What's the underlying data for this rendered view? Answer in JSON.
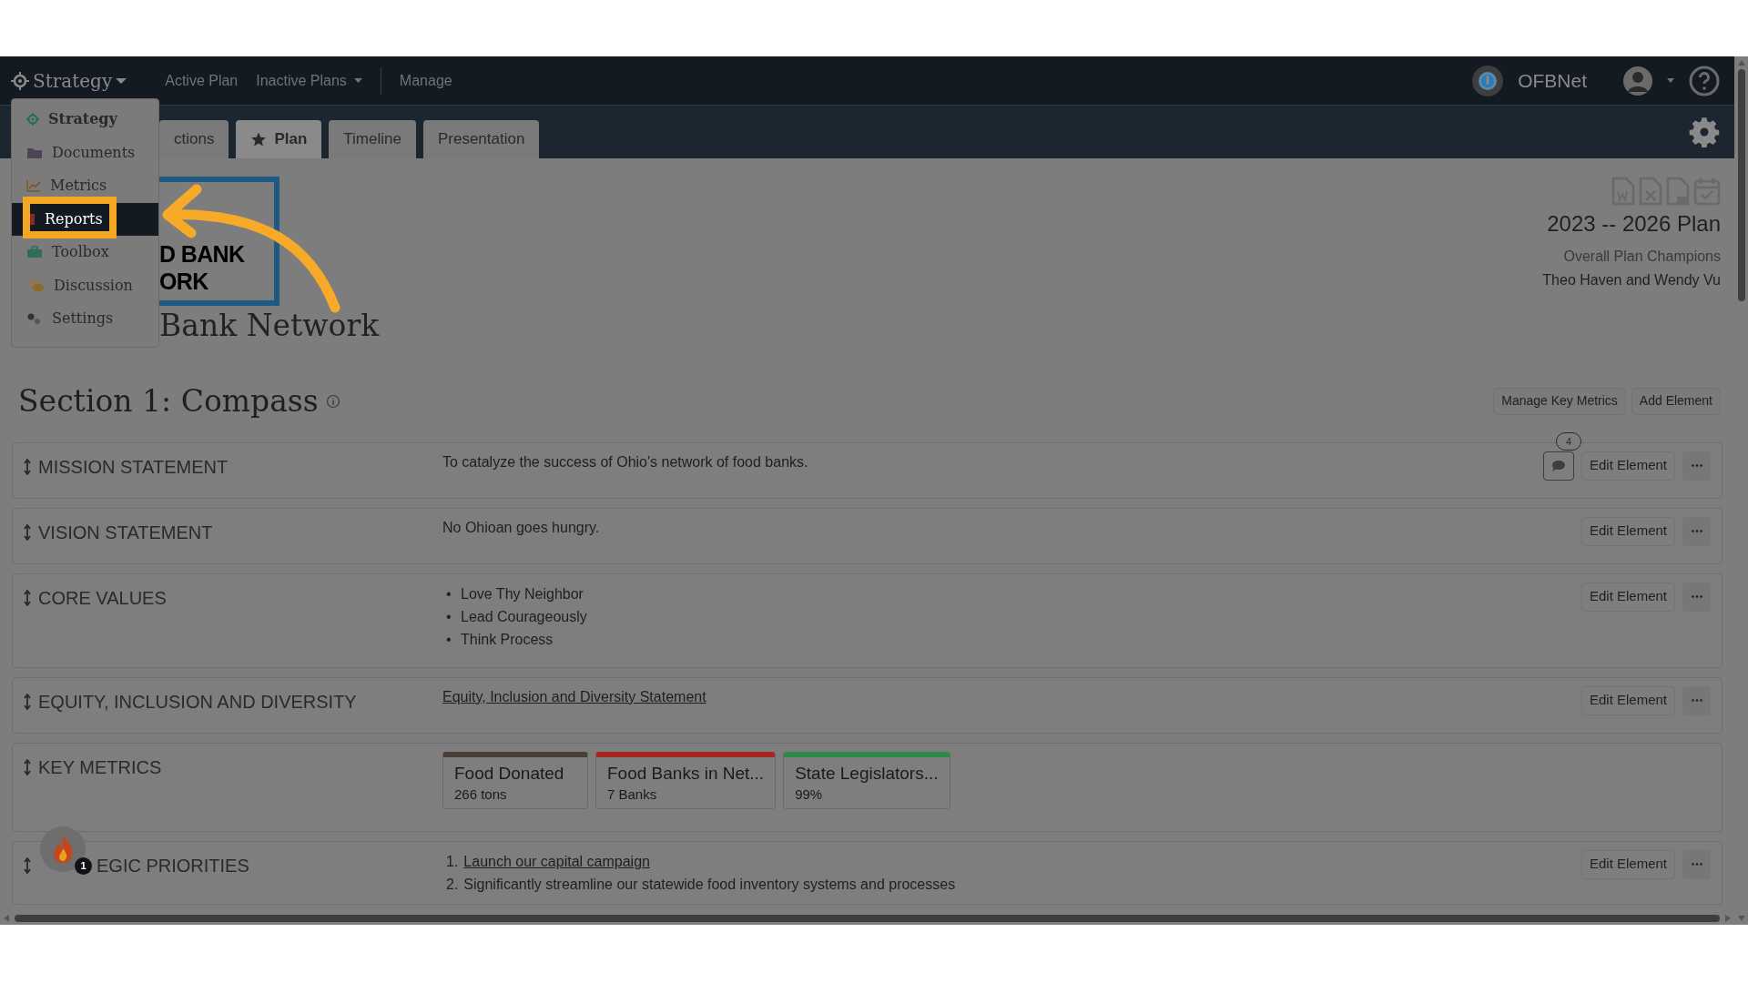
{
  "navbar": {
    "brand": "Strategy",
    "links": [
      {
        "label": "Active Plan",
        "dropdown": false
      },
      {
        "label": "Inactive Plans",
        "dropdown": true
      },
      {
        "label": "Manage",
        "dropdown": false
      }
    ],
    "org": "OFBNet"
  },
  "app_menu": [
    {
      "label": "Strategy",
      "kind": "strategy",
      "current": true,
      "selected": false
    },
    {
      "label": "Documents",
      "kind": "documents",
      "current": false,
      "selected": false
    },
    {
      "label": "Metrics",
      "kind": "metrics",
      "current": false,
      "selected": false
    },
    {
      "label": "Reports",
      "kind": "reports",
      "current": false,
      "selected": true
    },
    {
      "label": "Toolbox",
      "kind": "toolbox",
      "current": false,
      "selected": false
    },
    {
      "label": "Discussion",
      "kind": "discussion",
      "current": false,
      "selected": false
    },
    {
      "label": "Settings",
      "kind": "settings",
      "current": false,
      "selected": false
    }
  ],
  "tabs": [
    {
      "label": "ctions",
      "selected": false,
      "star": false
    },
    {
      "label": "Plan",
      "selected": true,
      "star": true
    },
    {
      "label": "Timeline",
      "selected": false,
      "star": false
    },
    {
      "label": "Presentation",
      "selected": false,
      "star": false
    }
  ],
  "logo": {
    "lines": [
      "D BANK",
      "ORK"
    ],
    "caption": "Bank Network"
  },
  "plan": {
    "title": "2023 -- 2026 Plan",
    "champions_label": "Overall Plan Champions",
    "champions": "Theo Haven and Wendy Vu"
  },
  "section": {
    "title": "Section 1: Compass",
    "buttons": [
      "Manage Key Metrics",
      "Add Element"
    ]
  },
  "elements": [
    {
      "kind": "text",
      "title": "MISSION STATEMENT",
      "text": "To catalyze the success of Ohio's network of food banks.",
      "comments": "4",
      "edit": "Edit Element"
    },
    {
      "kind": "text",
      "title": "VISION STATEMENT",
      "text": "No Ohioan goes hungry.",
      "edit": "Edit Element"
    },
    {
      "kind": "bullets",
      "title": "CORE VALUES",
      "items": [
        {
          "marker": "•",
          "text": "Love Thy Neighbor",
          "link": false
        },
        {
          "marker": "•",
          "text": "Lead Courageously",
          "link": false
        },
        {
          "marker": "•",
          "text": "Think Process",
          "link": false
        }
      ],
      "edit": "Edit Element"
    },
    {
      "kind": "link",
      "title": "EQUITY, INCLUSION AND DIVERSITY",
      "text": "Equity, Inclusion and Diversity Statement",
      "edit": "Edit Element"
    },
    {
      "kind": "metrics",
      "title": "KEY METRICS",
      "metrics": [
        {
          "name": "Food Donated",
          "value": "266 tons",
          "color": "#4a3f38"
        },
        {
          "name": "Food Banks in Net...",
          "value": "7 Banks",
          "color": "#a82620"
        },
        {
          "name": "State Legislators...",
          "value": "99%",
          "color": "#2e8a4a"
        }
      ]
    },
    {
      "kind": "numbered",
      "title": "EGIC PRIORITIES",
      "items": [
        {
          "marker": "1.",
          "text": "Launch our capital campaign",
          "link": true
        },
        {
          "marker": "2.",
          "text": "Significantly streamline our statewide food inventory systems and processes",
          "link": false
        }
      ],
      "edit": "Edit Element"
    }
  ],
  "notification": {
    "count": "1"
  }
}
